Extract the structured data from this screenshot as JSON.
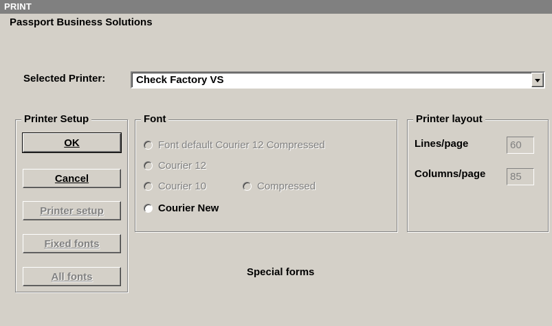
{
  "window": {
    "title": "PRINT"
  },
  "company_name": "Passport Business Solutions",
  "selected_printer": {
    "label": "Selected Printer:",
    "value": "Check Factory VS"
  },
  "printer_setup": {
    "title": "Printer Setup",
    "buttons": [
      {
        "label": "OK",
        "enabled": true
      },
      {
        "label": "Cancel",
        "enabled": true
      },
      {
        "label": "Printer setup",
        "enabled": false
      },
      {
        "label": "Fixed fonts",
        "enabled": false
      },
      {
        "label": "All fonts",
        "enabled": false
      }
    ]
  },
  "font": {
    "title": "Font",
    "options": [
      {
        "label": "Font default Courier 12 Compressed",
        "enabled": false
      },
      {
        "label": "Courier 12",
        "enabled": false
      },
      {
        "label": "Courier 10",
        "enabled": false
      },
      {
        "label": "Compressed",
        "enabled": false
      },
      {
        "label": "Courier New",
        "enabled": true
      }
    ]
  },
  "printer_layout": {
    "title": "Printer layout",
    "lines_label": "Lines/page",
    "lines_value": "60",
    "columns_label": "Columns/page",
    "columns_value": "85"
  },
  "special_forms": "Special forms",
  "colors": {
    "face": "#d4d0c8",
    "titlebar": "#808080",
    "disabled_text": "#808080"
  }
}
